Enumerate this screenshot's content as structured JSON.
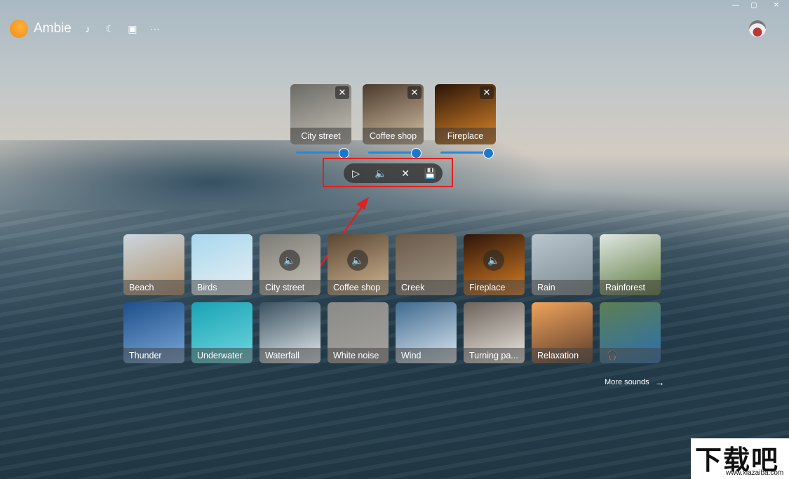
{
  "app": {
    "name": "Ambie"
  },
  "appbar": {
    "icons": [
      "music-note-icon",
      "moon-icon",
      "display-icon",
      "more-icon"
    ],
    "glyphs": {
      "music": "♪",
      "moon": "☾",
      "display": "▣",
      "more": "···"
    }
  },
  "window": {
    "minimize": "—",
    "maximize": "▢",
    "close": "✕"
  },
  "active_sounds": [
    {
      "label": "City street",
      "volume": 0.9,
      "colors": [
        "#6b6a66",
        "#c8c4b9"
      ]
    },
    {
      "label": "Coffee shop",
      "volume": 0.9,
      "colors": [
        "#4a3a2c",
        "#d8c3a8"
      ]
    },
    {
      "label": "Fireplace",
      "volume": 0.9,
      "colors": [
        "#2a1408",
        "#e08a2a"
      ]
    }
  ],
  "active_close_glyph": "✕",
  "controls": {
    "play": "▷",
    "volume": "🔈",
    "clear": "✕",
    "save": "💾"
  },
  "sounds": [
    {
      "label": "Beach",
      "colors": [
        "#c9d6df",
        "#b3916a"
      ],
      "playing": false
    },
    {
      "label": "Birds",
      "colors": [
        "#a8d8ee",
        "#e8eff2"
      ],
      "playing": false
    },
    {
      "label": "City street",
      "colors": [
        "#7c7b76",
        "#c9c4b8"
      ],
      "playing": true
    },
    {
      "label": "Coffee shop",
      "colors": [
        "#5a4633",
        "#d2b894"
      ],
      "playing": true
    },
    {
      "label": "Creek",
      "colors": [
        "#6b5a48",
        "#a29788"
      ],
      "playing": false
    },
    {
      "label": "Fireplace",
      "colors": [
        "#2c150a",
        "#d77d24"
      ],
      "playing": true
    },
    {
      "label": "Rain",
      "colors": [
        "#b8c6cf",
        "#7f8a90"
      ],
      "playing": false
    },
    {
      "label": "Rainforest",
      "colors": [
        "#dfe7e4",
        "#5e7a3c"
      ],
      "playing": false
    },
    {
      "label": "Thunder",
      "colors": [
        "#1f4f8a",
        "#7aa8d8"
      ],
      "playing": false
    },
    {
      "label": "Underwater",
      "colors": [
        "#1aa3b4",
        "#6fd8e0"
      ],
      "playing": false
    },
    {
      "label": "Waterfall",
      "colors": [
        "#3b5260",
        "#e5ecef"
      ],
      "playing": false
    },
    {
      "label": "White noise",
      "colors": [
        "#8a8a86",
        "#a3a29e"
      ],
      "playing": false
    },
    {
      "label": "Wind",
      "colors": [
        "#3f6a8f",
        "#dde8f0"
      ],
      "playing": false
    },
    {
      "label": "Turning pa...",
      "colors": [
        "#6c625a",
        "#ede9e3"
      ],
      "playing": false
    },
    {
      "label": "Relaxation",
      "colors": [
        "#f0a35c",
        "#5a3c2a"
      ],
      "playing": false
    },
    {
      "label": "",
      "colors": [
        "#5e7f52",
        "#2b6fae"
      ],
      "playing": false,
      "headphones": true
    }
  ],
  "speaker_glyph": "🔈",
  "headphones_glyph": "🎧",
  "more_sounds": {
    "label": "More sounds",
    "arrow": "→"
  },
  "watermark": {
    "main": "下载吧",
    "sub": "www.xiazaiba.com"
  }
}
